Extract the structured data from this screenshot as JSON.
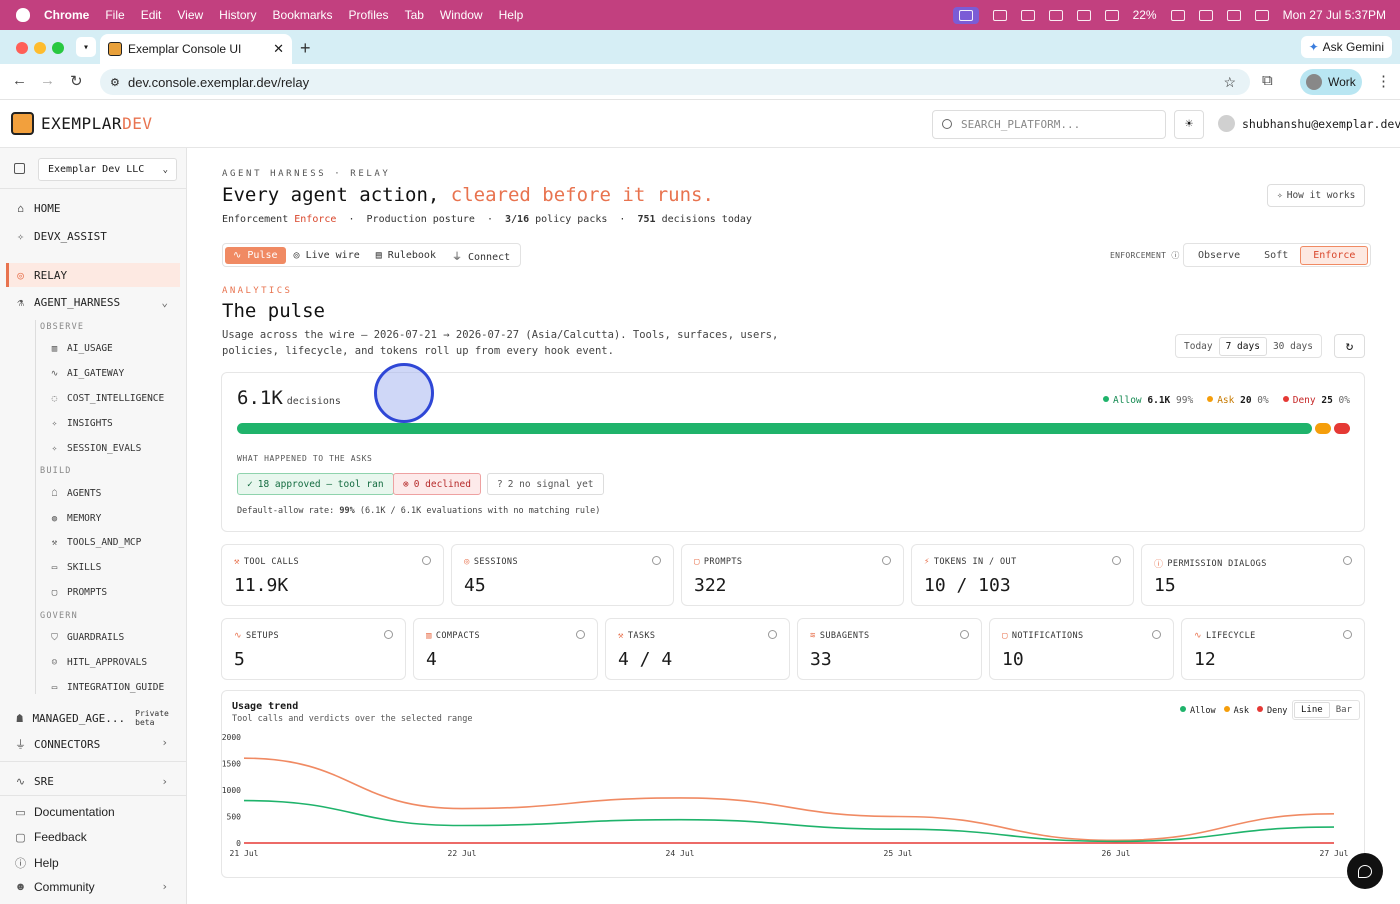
{
  "macbar": {
    "apple": "apple-logo",
    "app": "Chrome",
    "menus": [
      "File",
      "Edit",
      "View",
      "History",
      "Bookmarks",
      "Profiles",
      "Tab",
      "Window",
      "Help"
    ],
    "battery": "22%",
    "datetime": "Mon 27 Jul  5:37PM"
  },
  "browser": {
    "tab_title": "Exemplar Console UI",
    "url": "dev.console.exemplar.dev/relay",
    "ask_gemini": "Ask Gemini",
    "profile": "Work"
  },
  "header": {
    "logo_main": "EXEMPLAR",
    "logo_accent": "DEV",
    "search_placeholder": "SEARCH_PLATFORM...",
    "user": "shubhanshu@exemplar.dev"
  },
  "sidebar": {
    "org": "Exemplar Dev LLC",
    "home": "HOME",
    "devx": "DEVX_ASSIST",
    "relay": "RELAY",
    "agent_harness": "AGENT_HARNESS",
    "observe": "OBSERVE",
    "observe_items": [
      "AI_USAGE",
      "AI_GATEWAY",
      "COST_INTELLIGENCE",
      "INSIGHTS",
      "SESSION_EVALS"
    ],
    "build": "BUILD",
    "build_items": [
      "AGENTS",
      "MEMORY",
      "TOOLS_AND_MCP",
      "SKILLS",
      "PROMPTS"
    ],
    "govern": "GOVERN",
    "govern_items": [
      "GUARDRAILS",
      "HITL_APPROVALS",
      "INTEGRATION_GUIDE"
    ],
    "managed": "MANAGED_AGE...",
    "managed_badge": "Private beta",
    "connectors": "CONNECTORS",
    "sre": "SRE",
    "documentation": "Documentation",
    "feedback": "Feedback",
    "help": "Help",
    "community": "Community"
  },
  "page": {
    "kicker": "AGENT HARNESS · RELAY",
    "headline_a": "Every agent action,",
    "headline_b": "cleared before it runs.",
    "meta_enf_label": "Enforcement",
    "meta_enf_value": "Enforce",
    "meta_posture": "Production posture",
    "meta_packs_value": "3/16",
    "meta_packs_label": "policy packs",
    "meta_dec_value": "751",
    "meta_dec_label": "decisions today",
    "how_it_works": "How it works",
    "tabs": [
      "Pulse",
      "Live wire",
      "Rulebook",
      "Connect"
    ],
    "enforcement_label": "ENFORCEMENT",
    "enforcement_options": [
      "Observe",
      "Soft",
      "Enforce"
    ],
    "analytics": "ANALYTICS",
    "title": "The pulse",
    "desc": "Usage across the wire — 2026-07-21 → 2026-07-27 (Asia/Calcutta). Tools, surfaces, users, policies, lifecycle, and tokens roll up from every hook event.",
    "ranges": [
      "Today",
      "7 days",
      "30 days"
    ]
  },
  "decisions": {
    "total": "6.1K",
    "total_label": "decisions",
    "allow_label": "Allow",
    "allow_value": "6.1K",
    "allow_pct": "99%",
    "ask_label": "Ask",
    "ask_value": "20",
    "ask_pct": "0%",
    "deny_label": "Deny",
    "deny_value": "25",
    "deny_pct": "0%",
    "asks_label": "WHAT HAPPENED TO THE ASKS",
    "approved": "18 approved — tool ran",
    "declined": "0 declined",
    "nosignal": "2 no signal yet",
    "default_allow_prefix": "Default-allow rate:",
    "default_allow_value": "99%",
    "default_allow_suffix": "(6.1K / 6.1K evaluations with no matching rule)",
    "colors": {
      "allow": "#1fb36b",
      "ask": "#f59e0b",
      "deny": "#e53935"
    }
  },
  "stats_row1": [
    {
      "label": "TOOL CALLS",
      "value": "11.9K",
      "icon": "wrench-icon"
    },
    {
      "label": "SESSIONS",
      "value": "45",
      "icon": "radio-icon"
    },
    {
      "label": "PROMPTS",
      "value": "322",
      "icon": "message-icon"
    },
    {
      "label": "TOKENS IN / OUT",
      "value": "10 / 103",
      "icon": "zap-icon"
    },
    {
      "label": "PERMISSION DIALOGS",
      "value": "15",
      "icon": "help-circle-icon"
    }
  ],
  "stats_row2": [
    {
      "label": "SETUPS",
      "value": "5",
      "icon": "activity-icon"
    },
    {
      "label": "COMPACTS",
      "value": "4",
      "icon": "bar-chart-icon"
    },
    {
      "label": "TASKS",
      "value": "4 / 4",
      "icon": "wrench-icon"
    },
    {
      "label": "SUBAGENTS",
      "value": "33",
      "icon": "layers-icon"
    },
    {
      "label": "NOTIFICATIONS",
      "value": "10",
      "icon": "message-icon"
    },
    {
      "label": "LIFECYCLE",
      "value": "12",
      "icon": "activity-icon"
    }
  ],
  "trend": {
    "title": "Usage trend",
    "subtitle": "Tool calls and verdicts over the selected range",
    "legend": [
      "Allow",
      "Ask",
      "Deny"
    ],
    "modes": [
      "Line",
      "Bar"
    ]
  },
  "chart_data": {
    "type": "line",
    "x": [
      "21 Jul",
      "22 Jul",
      "24 Jul",
      "25 Jul",
      "26 Jul",
      "27 Jul"
    ],
    "yticks": [
      "2000",
      "1500",
      "1000",
      "500",
      "0"
    ],
    "series": [
      {
        "name": "Total",
        "color": "#f08a63",
        "values": [
          1600,
          650,
          850,
          500,
          50,
          550
        ]
      },
      {
        "name": "Allow",
        "color": "#1fb36b",
        "values": [
          800,
          330,
          440,
          260,
          30,
          300
        ]
      },
      {
        "name": "Deny",
        "color": "#e53935",
        "values": [
          0,
          0,
          0,
          0,
          0,
          0
        ]
      }
    ],
    "ylim": [
      0,
      2000
    ]
  }
}
